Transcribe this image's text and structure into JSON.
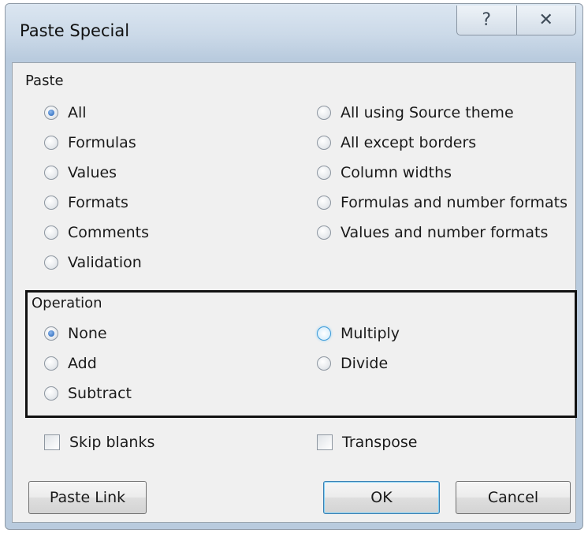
{
  "window": {
    "title": "Paste Special"
  },
  "titlebar": {
    "help_glyph": "?",
    "close_glyph": "✕"
  },
  "paste": {
    "label": "Paste",
    "options_left": [
      "All",
      "Formulas",
      "Values",
      "Formats",
      "Comments",
      "Validation"
    ],
    "options_right": [
      "All using Source theme",
      "All except borders",
      "Column widths",
      "Formulas and number formats",
      "Values and number formats"
    ],
    "selected": "All"
  },
  "operation": {
    "label": "Operation",
    "options_left": [
      "None",
      "Add",
      "Subtract"
    ],
    "options_right": [
      "Multiply",
      "Divide"
    ],
    "selected": "None"
  },
  "checkboxes": {
    "skip_blanks": "Skip blanks",
    "transpose": "Transpose"
  },
  "buttons": {
    "paste_link": "Paste Link",
    "ok": "OK",
    "cancel": "Cancel"
  }
}
